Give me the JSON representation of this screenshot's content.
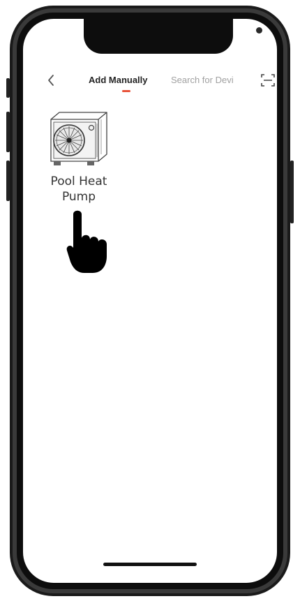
{
  "nav": {
    "tabs": [
      {
        "label": "Add Manually",
        "active": true
      },
      {
        "label": "Search for Devi",
        "active": false
      }
    ],
    "back_icon": "chevron-left-icon",
    "scan_icon": "scan-icon"
  },
  "devices": [
    {
      "label": "Pool Heat Pump",
      "icon": "heat-pump-icon"
    }
  ],
  "overlay": {
    "icon": "pointing-hand-icon"
  },
  "colors": {
    "accent": "#e8533a",
    "active_tab": "#222222",
    "inactive_tab": "#a0a0a0",
    "bezel": "#1a1a1a"
  }
}
